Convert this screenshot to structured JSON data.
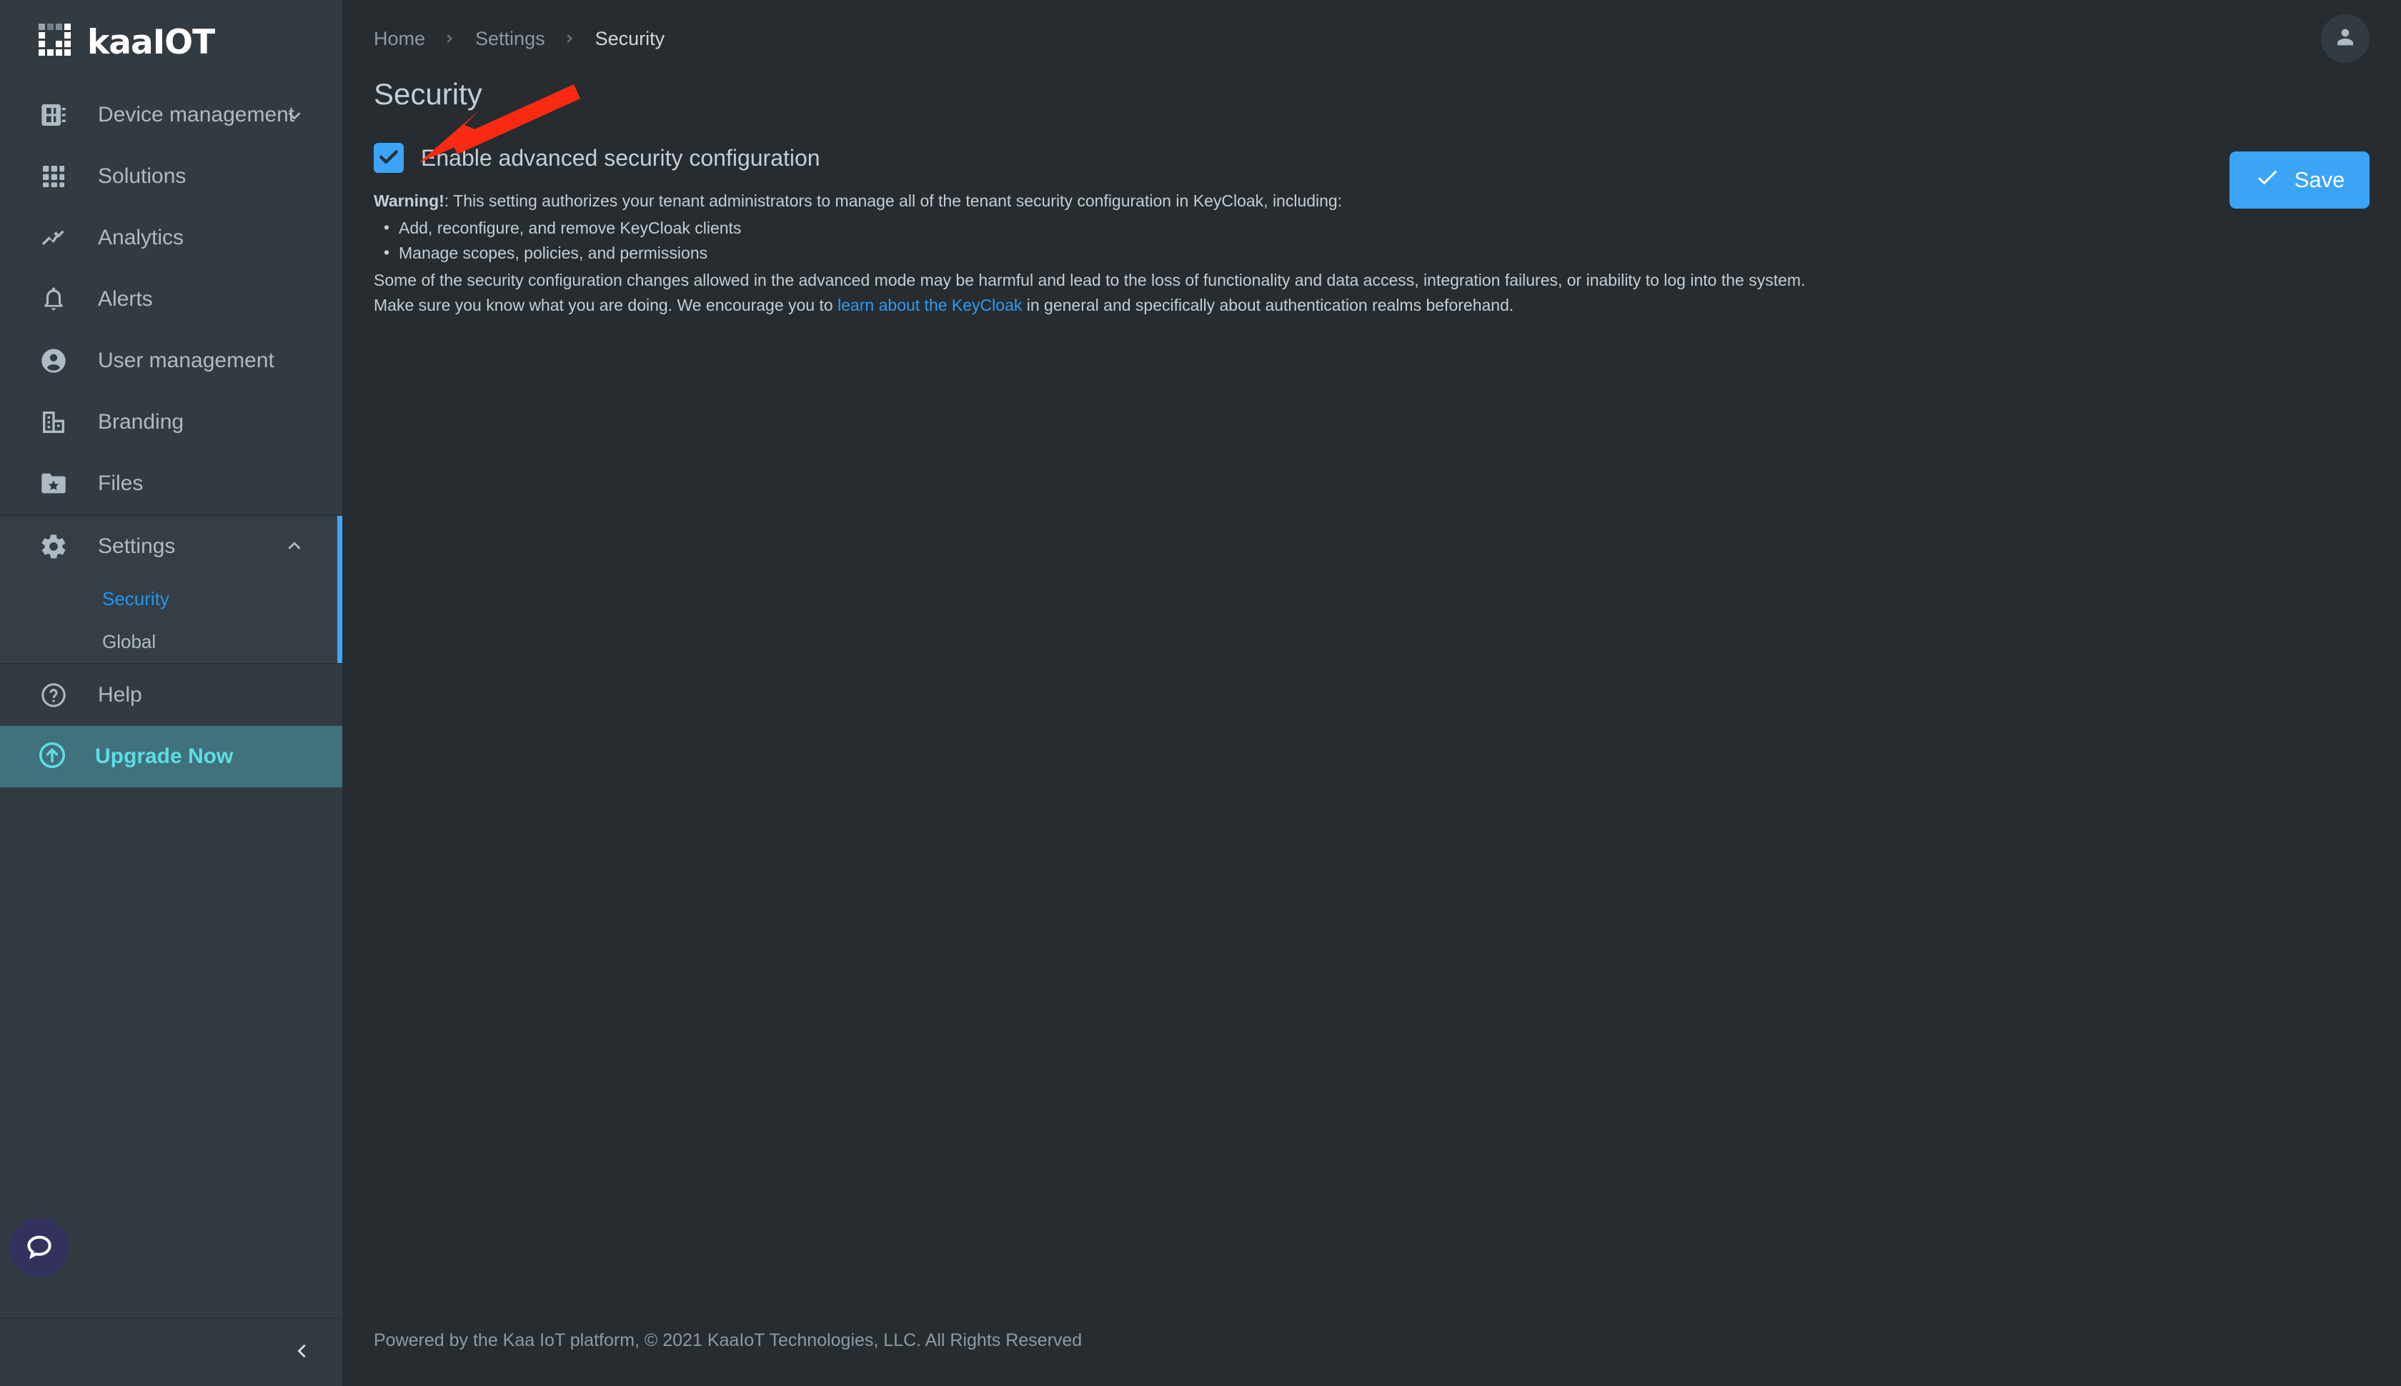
{
  "brand": {
    "logo_text": "kaaIOT",
    "logo_icon": "kaa-dot-matrix-logo"
  },
  "sidebar": {
    "items": [
      {
        "label": "Device management",
        "icon": "device-management-icon",
        "has_chevron": true,
        "chevron": "chevron-down-icon"
      },
      {
        "label": "Solutions",
        "icon": "solutions-grid-icon",
        "has_chevron": false
      },
      {
        "label": "Analytics",
        "icon": "analytics-chart-icon",
        "has_chevron": false
      },
      {
        "label": "Alerts",
        "icon": "bell-icon",
        "has_chevron": false
      },
      {
        "label": "User management",
        "icon": "user-circle-icon",
        "has_chevron": false
      },
      {
        "label": "Branding",
        "icon": "building-icon",
        "has_chevron": false
      },
      {
        "label": "Files",
        "icon": "folder-star-icon",
        "has_chevron": false
      }
    ],
    "settings": {
      "label": "Settings",
      "icon": "gear-icon",
      "chevron": "chevron-up-icon",
      "expanded": true,
      "subitems": [
        {
          "label": "Security",
          "active": true
        },
        {
          "label": "Global",
          "active": false
        }
      ]
    },
    "help": {
      "label": "Help",
      "icon": "help-circle-icon"
    },
    "upgrade": {
      "label": "Upgrade Now",
      "icon": "arrow-up-circle-icon"
    },
    "chat": {
      "icon": "chat-bubble-icon"
    },
    "collapse": {
      "icon": "chevron-left-icon"
    }
  },
  "header": {
    "breadcrumb": [
      {
        "label": "Home"
      },
      {
        "label": "Settings"
      },
      {
        "label": "Security"
      }
    ],
    "breadcrumb_separator_icon": "chevron-right-icon",
    "avatar_icon": "person-icon"
  },
  "page": {
    "title": "Security",
    "save_button": {
      "label": "Save",
      "icon": "check-icon"
    }
  },
  "security_form": {
    "checkbox": {
      "label": "Enable advanced security configuration",
      "checked": true,
      "icon": "checkmark-icon"
    },
    "warning": {
      "intro_bold": "Warning!",
      "intro_rest": ": This setting authorizes your tenant administrators to manage all of the tenant security configuration in KeyCloak, including:",
      "bullets": [
        "Add, reconfigure, and remove KeyCloak clients",
        "Manage scopes, policies, and permissions"
      ],
      "paragraph": "Some of the security configuration changes allowed in the advanced mode may be harmful and lead to the loss of functionality and data access, integration failures, or inability to log into the system.",
      "closing_before_link": "Make sure you know what you are doing. We encourage you to ",
      "link_text": "learn about the KeyCloak",
      "closing_after_link": " in general and specifically about authentication realms beforehand."
    }
  },
  "footer": {
    "text": "Powered by the Kaa IoT platform, © 2021 KaaIoT Technologies, LLC. All Rights Reserved"
  },
  "annotation": {
    "arrow_color": "#fa2a12",
    "description": "red-arrow-pointing-to-checkbox"
  },
  "colors": {
    "sidebar_bg": "#333b42",
    "sidebar_section_bg": "#353e45",
    "main_bg": "#272c30",
    "accent_blue": "#3ca4f7",
    "link_blue": "#2f9cf4",
    "upgrade_bg": "#3f727c",
    "upgrade_text": "#5fdde5",
    "text_primary": "#c3ced6",
    "text_muted": "#8d9aa3"
  }
}
